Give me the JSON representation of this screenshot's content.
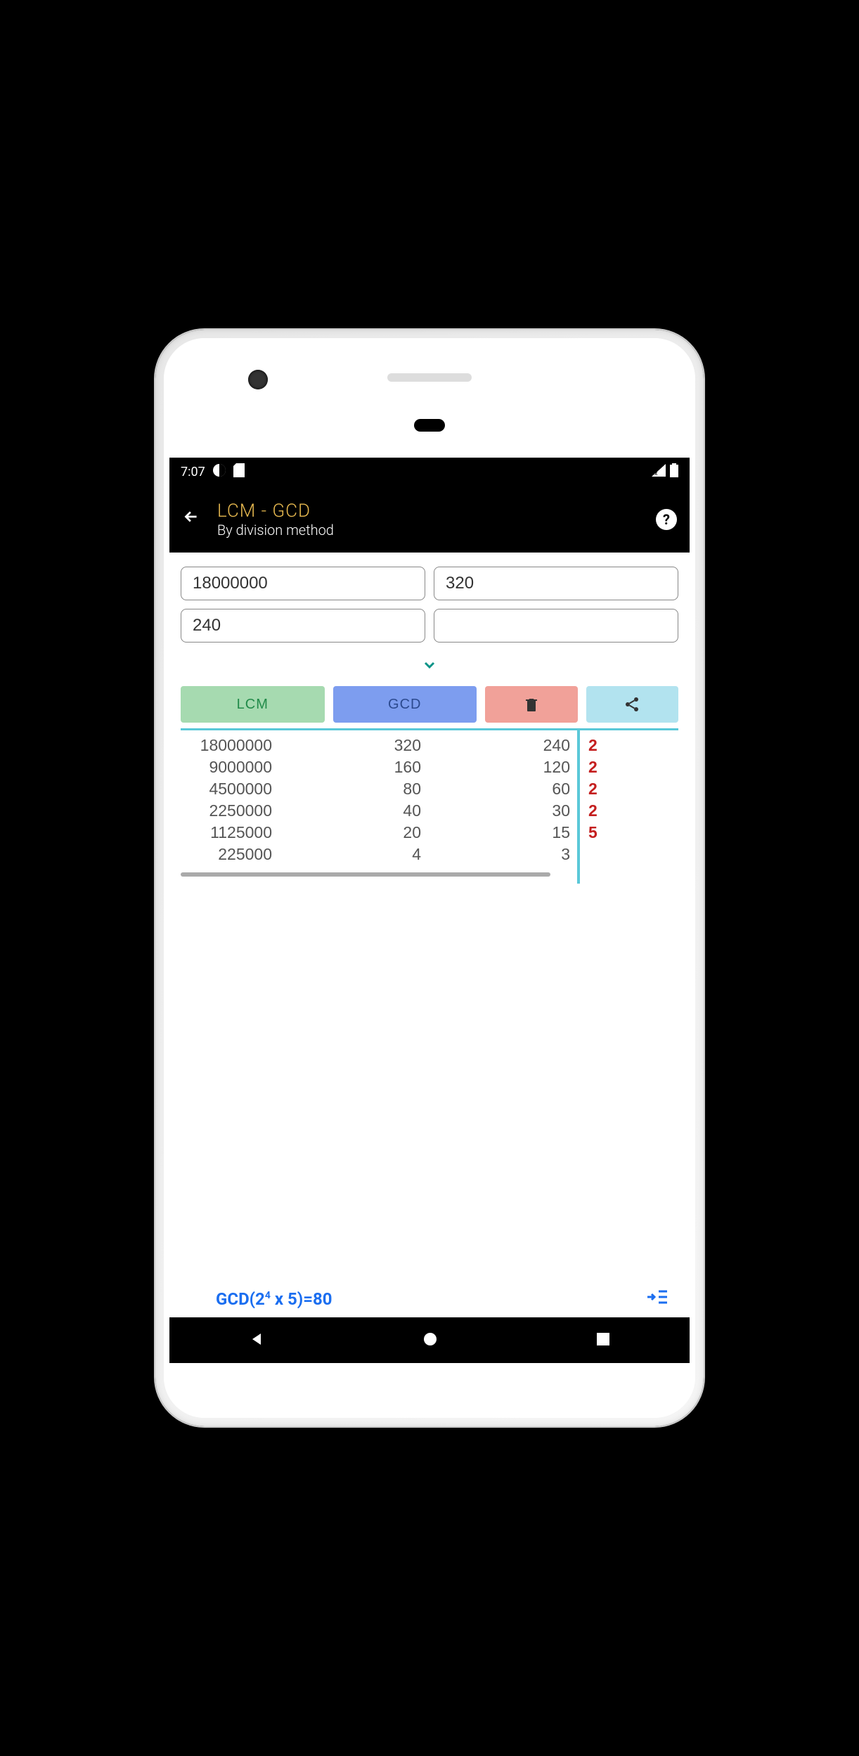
{
  "status": {
    "time": "7:07"
  },
  "header": {
    "title": "LCM - GCD",
    "subtitle": "By division method"
  },
  "inputs": {
    "a": "18000000",
    "b": "320",
    "c": "240",
    "d": ""
  },
  "buttons": {
    "lcm": "LCM",
    "gcd": "GCD"
  },
  "table": {
    "rows": [
      {
        "c1": "18000000",
        "c2": "320",
        "c3": "240"
      },
      {
        "c1": "9000000",
        "c2": "160",
        "c3": "120"
      },
      {
        "c1": "4500000",
        "c2": "80",
        "c3": "60"
      },
      {
        "c1": "2250000",
        "c2": "40",
        "c3": "30"
      },
      {
        "c1": "1125000",
        "c2": "20",
        "c3": "15"
      },
      {
        "c1": "225000",
        "c2": "4",
        "c3": "3"
      }
    ],
    "factors": [
      "2",
      "2",
      "2",
      "2",
      "5"
    ]
  },
  "result": {
    "prefix": "GCD(2",
    "exp": "4",
    "suffix": " x 5)=80"
  }
}
